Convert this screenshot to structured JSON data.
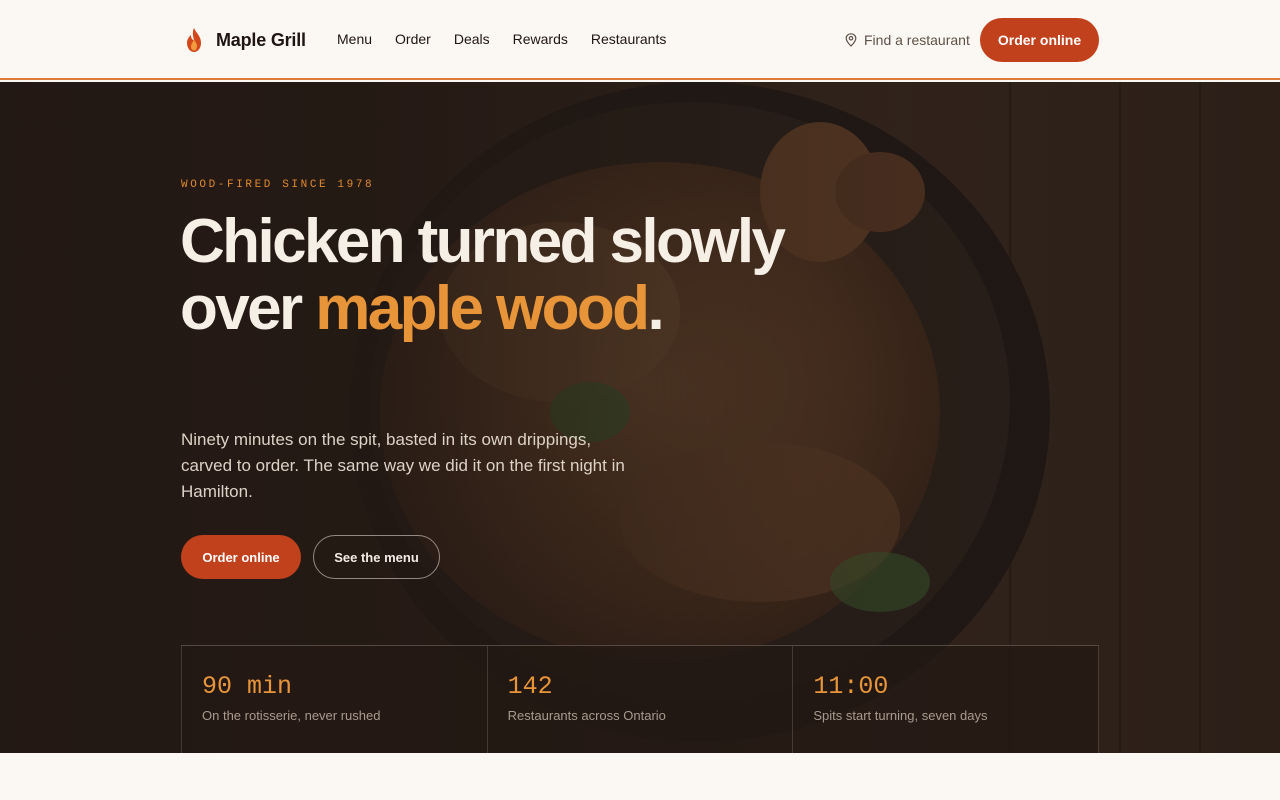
{
  "brand": {
    "name": "Maple Grill",
    "logo_icon": "flame-icon",
    "accent": "#e07a3a"
  },
  "nav": {
    "items": [
      {
        "label": "Menu"
      },
      {
        "label": "Order"
      },
      {
        "label": "Deals"
      },
      {
        "label": "Rewards"
      },
      {
        "label": "Restaurants"
      }
    ],
    "find_label": "Find a restaurant",
    "find_icon": "map-pin-icon",
    "order_label": "Order online"
  },
  "hero": {
    "eyebrow": "WOOD-FIRED SINCE 1978",
    "headline_part1": "Chicken turned slowly over ",
    "headline_accent": "maple wood",
    "headline_end": ".",
    "lead": "Ninety minutes on the spit, basted in its own drippings, carved to order. The same way we did it on the first night in Hamilton.",
    "primary_cta": "Order online",
    "secondary_cta": "See the menu"
  },
  "stats": [
    {
      "value": "90 min",
      "label": "On the rotisserie, never rushed"
    },
    {
      "value": "142",
      "label": "Restaurants across Ontario"
    },
    {
      "value": "11:00",
      "label": "Spits start turning, seven days"
    }
  ],
  "colors": {
    "primary_button": "#c1411d",
    "accent_text": "#e8953a",
    "hero_bg": "#261b16",
    "page_bg": "#fbf8f3"
  }
}
